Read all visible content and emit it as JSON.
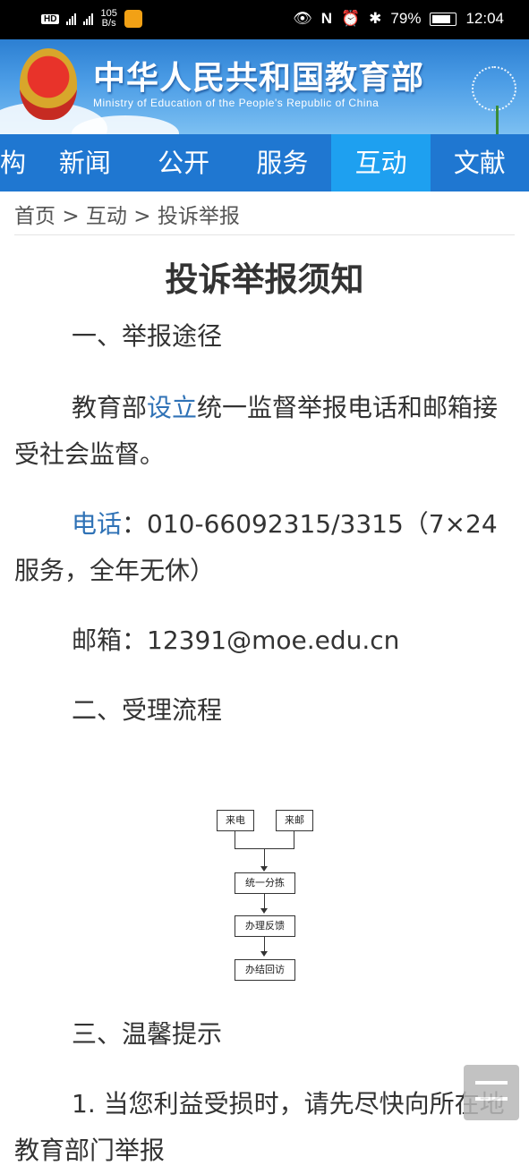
{
  "status_bar": {
    "hd_label": "HD",
    "net_speed_value": "105",
    "net_speed_unit": "B/s",
    "battery": "79%",
    "time": "12:04"
  },
  "banner": {
    "title": "中华人民共和国教育部",
    "subtitle": "Ministry of Education of the People's Republic of China",
    "colors": {
      "sky": "#2c7fd2",
      "title_text": "#ffffff"
    }
  },
  "nav": {
    "items": [
      {
        "label": "构"
      },
      {
        "label": "新闻"
      },
      {
        "label": "公开"
      },
      {
        "label": "服务"
      },
      {
        "label": "互动",
        "active": true
      },
      {
        "label": "文献"
      }
    ],
    "colors": {
      "bar": "#1f77d1",
      "active": "#1ea0f0"
    }
  },
  "breadcrumb": {
    "home": "首页",
    "sep1": ">",
    "section": "互动",
    "sep2": ">",
    "current": "投诉举报"
  },
  "article": {
    "title": "投诉举报须知",
    "h1": "一、举报途径",
    "p1_pre": "教育部",
    "p1_link": "设立",
    "p1_post": "统一监督举报电话和邮箱接受社会监督。",
    "phone_label": "电话",
    "phone_text": "：010-66092315/3315（7×24服务，全年无休）",
    "email_text": "邮箱：12391@moe.edu.cn",
    "h2": "二、受理流程",
    "flow": {
      "box_phone": "来电",
      "box_mail": "来邮",
      "box_sort": "统一分拣",
      "box_handle": "办理反馈",
      "box_visit": "办结回访"
    },
    "h3": "三、温馨提示",
    "tip1": "1. 当您利益受损时，请先尽快向所在地教育部门举报"
  },
  "icons": [
    "signal-icon",
    "wifi-icon",
    "app-icon",
    "eye-icon",
    "nfc-icon",
    "alarm-icon",
    "bluetooth-icon",
    "battery-icon",
    "menu-icon"
  ]
}
